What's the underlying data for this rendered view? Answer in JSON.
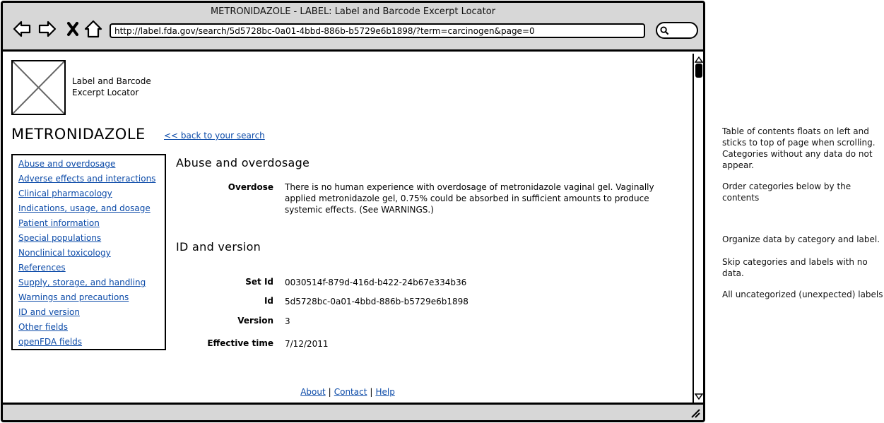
{
  "window": {
    "title": "METRONIDAZOLE - LABEL: Label and Barcode Excerpt Locator",
    "url": "http://label.fda.gov/search/5d5728bc-0a01-4bbd-886b-b5729e6b1898/?term=carcinogen&page=0"
  },
  "icons": {
    "back": "back-arrow-icon",
    "forward": "forward-arrow-icon",
    "stop": "close-icon",
    "home": "home-icon",
    "search": "search-icon"
  },
  "header": {
    "logo_line1": "Label and Barcode",
    "logo_line2": "Excerpt Locator",
    "title": "METRONIDAZOLE",
    "back_link": "<< back to your search"
  },
  "toc": {
    "items": [
      "Abuse and overdosage",
      "Adverse effects and interactions",
      "Clinical pharmacology",
      "Indications, usage, and dosage",
      "Patient information",
      "Special populations",
      "Nonclinical toxicology",
      "References",
      "Supply, storage, and handling",
      "Warnings and precautions",
      "ID and version",
      "Other fields",
      "openFDA fields"
    ]
  },
  "sections": {
    "abuse": {
      "heading": "Abuse and overdosage",
      "overdose_label": "Overdose",
      "overdose_value": "There is no human experience with overdosage of metronidazole vaginal gel. Vaginally applied metronidazole gel, 0.75% could be absorbed in sufficient amounts to produce systemic effects. (See WARNINGS.)"
    },
    "id_version": {
      "heading": "ID and version",
      "set_id_label": "Set Id",
      "set_id_value": "0030514f-879d-416d-b422-24b67e334b36",
      "id_label": "Id",
      "id_value": "5d5728bc-0a01-4bbd-886b-b5729e6b1898",
      "version_label": "Version",
      "version_value": "3",
      "effective_label": "Effective time",
      "effective_value": "7/12/2011"
    }
  },
  "footer": {
    "about": "About",
    "contact": "Contact",
    "help": "Help",
    "separator": "|"
  },
  "annotations": {
    "note1": "Table of contents floats on left and sticks to top of page when scrolling. Categories without any data do not appear.",
    "note2": "Order categories below by the contents",
    "note3": "Organize data by category and label.",
    "note4": "Skip categories and labels with no data.",
    "note5": "All uncategorized (unexpected) labels"
  }
}
